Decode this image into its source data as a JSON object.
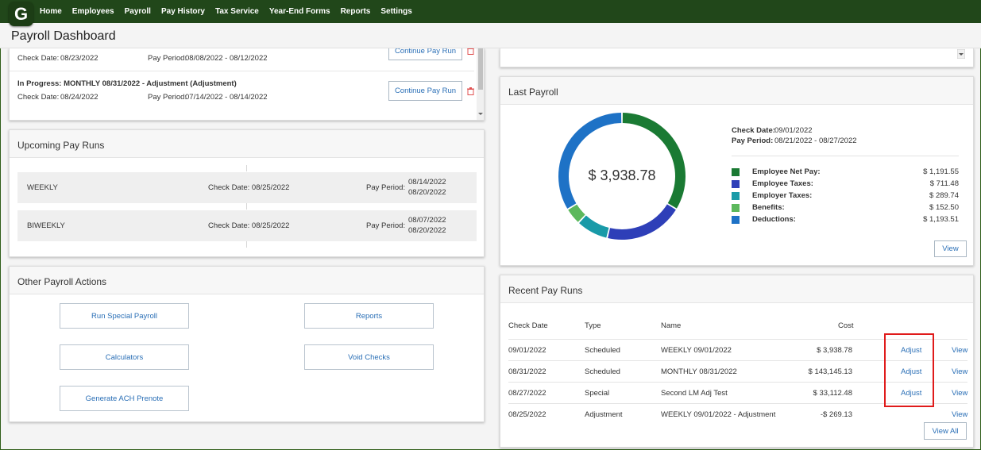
{
  "app": {
    "logo_letter": "G",
    "brand_color": "#21471a"
  },
  "nav": [
    "Home",
    "Employees",
    "Payroll",
    "Pay History",
    "Tax Service",
    "Year-End Forms",
    "Reports",
    "Settings"
  ],
  "page_title": "Payroll Dashboard",
  "in_progress": {
    "rows": [
      {
        "title": "",
        "check_date_label": "Check Date:",
        "check_date": "08/23/2022",
        "pay_period_label": "Pay Period:",
        "pay_period": "08/08/2022 - 08/12/2022",
        "button": "Continue Pay Run"
      },
      {
        "title": "In Progress: MONTHLY 08/31/2022 - Adjustment (Adjustment)",
        "check_date_label": "Check Date:",
        "check_date": "08/24/2022",
        "pay_period_label": "Pay Period:",
        "pay_period": "07/14/2022 - 08/14/2022",
        "button": "Continue Pay Run"
      }
    ]
  },
  "upcoming": {
    "title": "Upcoming Pay Runs",
    "rows": [
      {
        "frequency": "WEEKLY",
        "check_date": "Check Date: 08/25/2022",
        "pay_period_label": "Pay Period:",
        "period_start": "08/14/2022",
        "period_end": "08/20/2022"
      },
      {
        "frequency": "BIWEEKLY",
        "check_date": "Check Date: 08/25/2022",
        "pay_period_label": "Pay Period:",
        "period_start": "08/07/2022",
        "period_end": "08/20/2022"
      }
    ]
  },
  "actions": {
    "title": "Other Payroll Actions",
    "buttons": [
      "Run Special Payroll",
      "Reports",
      "Calculators",
      "Void Checks",
      "Generate ACH Prenote"
    ]
  },
  "last_payroll": {
    "title": "Last Payroll",
    "total": "$ 3,938.78",
    "check_date_label": "Check Date:",
    "check_date": "09/01/2022",
    "pay_period_label": "Pay Period:",
    "pay_period": "08/21/2022 - 08/27/2022",
    "view": "View",
    "legend": [
      {
        "name": "Employee Net Pay:",
        "value": "$ 1,191.55",
        "amount": 1191.55,
        "color": "#1a7a33"
      },
      {
        "name": "Employee Taxes:",
        "value": "$ 711.48",
        "amount": 711.48,
        "color": "#2e3fb8"
      },
      {
        "name": "Employer Taxes:",
        "value": "$ 289.74",
        "amount": 289.74,
        "color": "#199aa8"
      },
      {
        "name": "Benefits:",
        "value": "$ 152.50",
        "amount": 152.5,
        "color": "#5cb85c"
      },
      {
        "name": "Deductions:",
        "value": "$ 1,193.51",
        "amount": 1193.51,
        "color": "#1e72c6"
      }
    ]
  },
  "recent": {
    "title": "Recent Pay Runs",
    "headers": {
      "check_date": "Check Date",
      "type": "Type",
      "name": "Name",
      "cost": "Cost"
    },
    "rows": [
      {
        "check_date": "09/01/2022",
        "type": "Scheduled",
        "name": "WEEKLY 09/01/2022",
        "cost": "$ 3,938.78",
        "adjust": "Adjust",
        "view": "View"
      },
      {
        "check_date": "08/31/2022",
        "type": "Scheduled",
        "name": "MONTHLY 08/31/2022",
        "cost": "$ 143,145.13",
        "adjust": "Adjust",
        "view": "View"
      },
      {
        "check_date": "08/27/2022",
        "type": "Special",
        "name": "Second LM Adj Test",
        "cost": "$ 33,112.48",
        "adjust": "Adjust",
        "view": "View"
      },
      {
        "check_date": "08/25/2022",
        "type": "Adjustment",
        "name": "WEEKLY 09/01/2022 - Adjustment",
        "cost": "-$ 269.13",
        "adjust": "",
        "view": "View"
      }
    ],
    "view_all": "View All"
  },
  "highlight_color": "#e01b1b"
}
